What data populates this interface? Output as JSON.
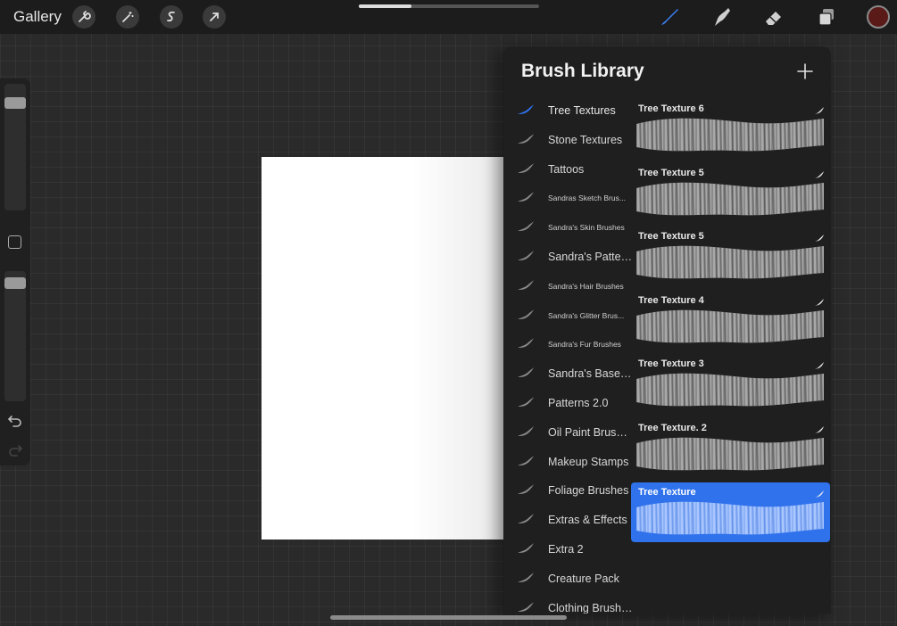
{
  "topbar": {
    "gallery_label": "Gallery",
    "left_tools": [
      "wrench-icon",
      "magic-wand-icon",
      "selection-icon",
      "transform-arrow-icon"
    ],
    "right_tools": [
      "brush-icon",
      "smudge-icon",
      "eraser-icon",
      "layers-icon"
    ],
    "active_tool": "brush-icon",
    "progress": 0.29,
    "current_color": "#5a1a18"
  },
  "sidebar": {
    "brush_size_level": 0.12,
    "opacity_level": 0.05
  },
  "panel": {
    "title": "Brush Library",
    "add_icon": "plus-icon",
    "accent_color": "#2f72ec",
    "brush_sets": [
      {
        "label": "Tree Textures",
        "size": "big",
        "active": true
      },
      {
        "label": "Stone Textures",
        "size": "big",
        "active": false
      },
      {
        "label": "Tattoos",
        "size": "big",
        "active": false
      },
      {
        "label": "Sandras Sketch Brus...",
        "size": "small",
        "active": false
      },
      {
        "label": "Sandra's Skin Brushes",
        "size": "small",
        "active": false
      },
      {
        "label": "Sandra's Patterns",
        "size": "big",
        "active": false
      },
      {
        "label": "Sandra's Hair Brushes",
        "size": "small",
        "active": false
      },
      {
        "label": "Sandra's Glitter Brus...",
        "size": "small",
        "active": false
      },
      {
        "label": "Sandra's Fur Brushes",
        "size": "small",
        "active": false
      },
      {
        "label": "Sandra's Base Set",
        "size": "big",
        "active": false
      },
      {
        "label": "Patterns 2.0",
        "size": "big",
        "active": false
      },
      {
        "label": "Oil Paint Brushes",
        "size": "big",
        "active": false
      },
      {
        "label": "Makeup Stamps",
        "size": "big",
        "active": false
      },
      {
        "label": "Foliage Brushes",
        "size": "big",
        "active": false
      },
      {
        "label": "Extras & Effects",
        "size": "big",
        "active": false
      },
      {
        "label": "Extra 2",
        "size": "big",
        "active": false
      },
      {
        "label": "Creature Pack",
        "size": "big",
        "active": false
      },
      {
        "label": "Clothing Brushes",
        "size": "big",
        "active": false
      }
    ],
    "brushes": [
      {
        "name": "Tree Texture 6",
        "selected": false
      },
      {
        "name": "Tree Texture 5",
        "selected": false
      },
      {
        "name": "Tree Texture 5",
        "selected": false
      },
      {
        "name": "Tree Texture 4",
        "selected": false
      },
      {
        "name": "Tree Texture 3",
        "selected": false
      },
      {
        "name": "Tree Texture. 2",
        "selected": false
      },
      {
        "name": "Tree Texture",
        "selected": true
      }
    ]
  }
}
